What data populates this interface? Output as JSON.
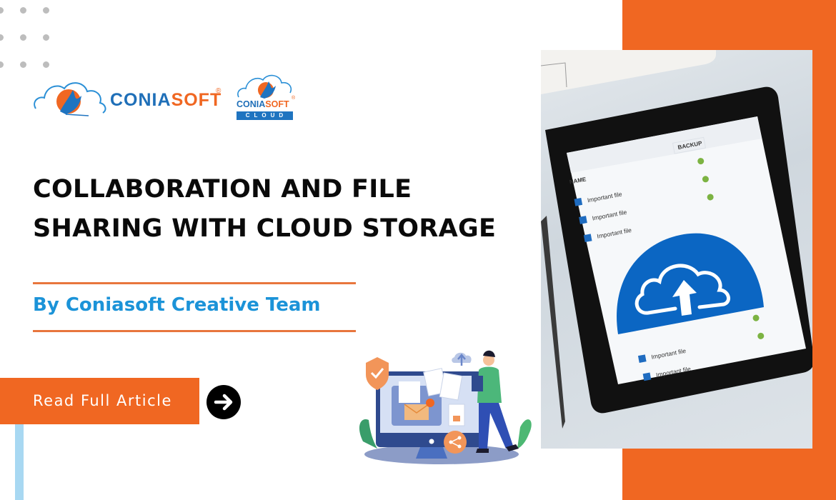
{
  "brand": {
    "logo_main": {
      "part1": "CONIA",
      "part2": "SOFT",
      "registered": "®"
    },
    "logo_cloud": {
      "part1": "CONIA",
      "part2": "SOFT",
      "sub": "CLOUD",
      "registered": "®"
    }
  },
  "headline": {
    "line1": "COLLABORATION AND FILE",
    "line2": "SHARING WITH CLOUD STORAGE"
  },
  "byline": "By Coniasoft Creative Team",
  "cta": {
    "label": "Read Full Article",
    "arrow_icon": "arrow-right-icon"
  },
  "tablet_screen": {
    "column_headers": {
      "name": "NAME",
      "backup": "BACKUP"
    },
    "rows_top": [
      {
        "label": "Important file",
        "checked": true,
        "backed_up": true
      },
      {
        "label": "Important file",
        "checked": true,
        "backed_up": true
      },
      {
        "label": "Important file",
        "checked": true,
        "backed_up": true
      }
    ],
    "rows_bottom": [
      {
        "label": "Important file",
        "checked": true,
        "backed_up": true
      },
      {
        "label": "Important file",
        "checked": true,
        "backed_up": true
      }
    ],
    "center_icon": "cloud-upload-icon"
  },
  "colors": {
    "orange": "#f06722",
    "author_blue": "#1b93d8",
    "brand_blue": "#1f6fb8",
    "light_blue_strip": "#a8d8f2",
    "cloud_icon_blue": "#0b66c3",
    "check_green": "#7cb342"
  }
}
